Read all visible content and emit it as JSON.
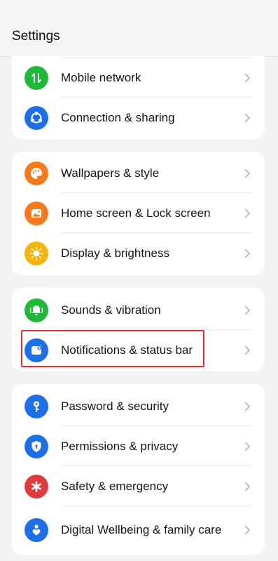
{
  "header": {
    "title": "Settings"
  },
  "groups": [
    {
      "items": [
        {
          "label": "Mobile network",
          "icon": "mobile-network-icon",
          "color": "#1fb83a"
        },
        {
          "label": "Connection & sharing",
          "icon": "share-icon",
          "color": "#1e6fe6"
        }
      ]
    },
    {
      "items": [
        {
          "label": "Wallpapers & style",
          "icon": "palette-icon",
          "color": "#f47a1c"
        },
        {
          "label": "Home screen & Lock screen",
          "icon": "image-icon",
          "color": "#f47a1c"
        },
        {
          "label": "Display & brightness",
          "icon": "sun-icon",
          "color": "#f5b50e"
        }
      ]
    },
    {
      "items": [
        {
          "label": "Sounds & vibration",
          "icon": "bell-icon",
          "color": "#1fb83a"
        },
        {
          "label": "Notifications & status bar",
          "icon": "notification-icon",
          "color": "#1e6fe6"
        }
      ]
    },
    {
      "items": [
        {
          "label": "Password & security",
          "icon": "key-icon",
          "color": "#1e6fe6"
        },
        {
          "label": "Permissions & privacy",
          "icon": "shield-icon",
          "color": "#1e6fe6"
        },
        {
          "label": "Safety & emergency",
          "icon": "asterisk-icon",
          "color": "#e23b3b"
        },
        {
          "label": "Digital Wellbeing & family care",
          "icon": "wellbeing-icon",
          "color": "#1e6fe6"
        }
      ]
    }
  ],
  "highlight_color": "#e8302f"
}
